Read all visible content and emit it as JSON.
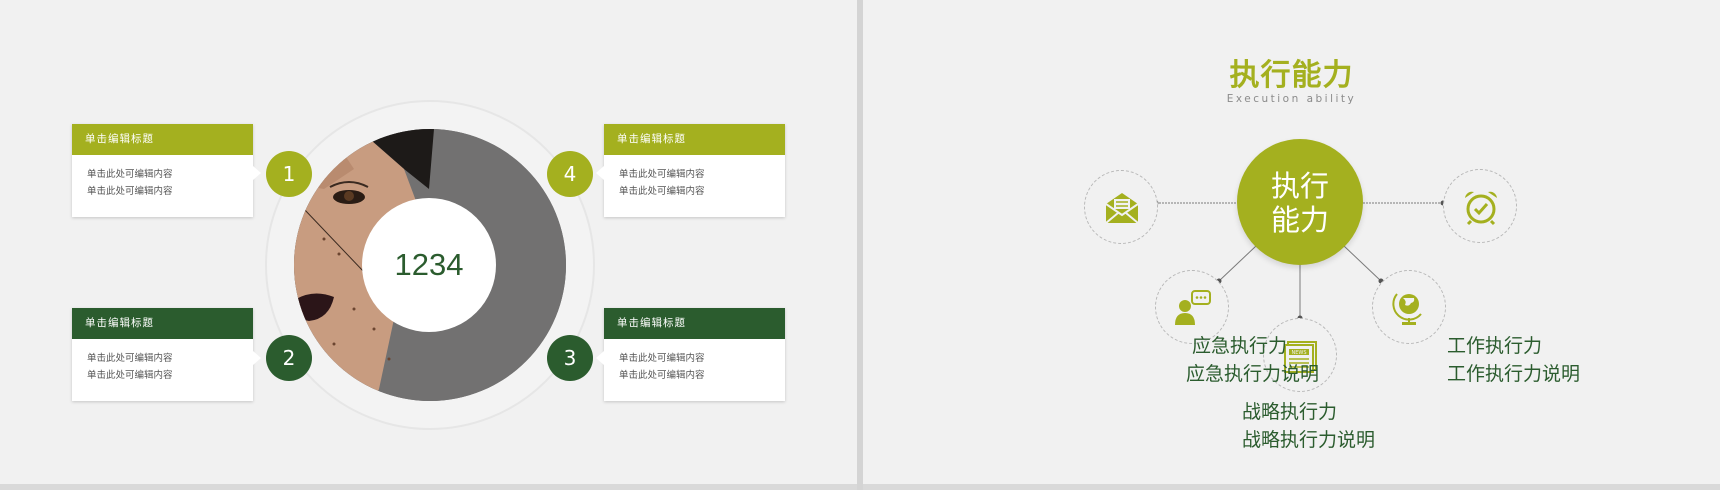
{
  "left_slide": {
    "cards": [
      {
        "title": "单击编辑标题",
        "line1": "单击此处可编辑内容",
        "line2": "单击此处可编辑内容",
        "number": "1"
      },
      {
        "title": "单击编辑标题",
        "line1": "单击此处可编辑内容",
        "line2": "单击此处可编辑内容",
        "number": "2"
      },
      {
        "title": "单击编辑标题",
        "line1": "单击此处可编辑内容",
        "line2": "单击此处可编辑内容",
        "number": "3"
      },
      {
        "title": "单击编辑标题",
        "line1": "单击此处可编辑内容",
        "line2": "单击此处可编辑内容",
        "number": "4"
      }
    ],
    "center_text": "1234"
  },
  "right_slide": {
    "title": "执行能力",
    "subtitle": "Execution ability",
    "hub_line1": "执行",
    "hub_line2": "能力",
    "labels": {
      "emergency_title": "应急执行力",
      "emergency_desc": "应急执行力说明",
      "strategy_title": "战略执行力",
      "strategy_desc": "战略执行力说明",
      "work_title": "工作执行力",
      "work_desc": "工作执行力说明"
    },
    "icons": [
      "mail-icon",
      "user-chat-icon",
      "newspaper-icon",
      "globe-icon",
      "alarm-clock-icon"
    ]
  },
  "colors": {
    "lime": "#a4b01f",
    "dark_green": "#2b5c2e",
    "background": "#f1f1f1"
  }
}
